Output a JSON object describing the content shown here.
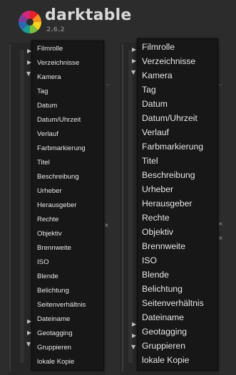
{
  "header": {
    "app_name": "darktable",
    "version": "2.6.2"
  },
  "colors": {
    "background": "#2c2c2c",
    "menu_background": "#171717",
    "menu_text": "#e6e6e6",
    "logo_segments": [
      "#e8202a",
      "#f39220",
      "#f7d51c",
      "#7cbf3b",
      "#1d9b8f",
      "#2a67b1",
      "#7a3f98",
      "#d0287a"
    ]
  },
  "icons": {
    "logo": "darktable-aperture-logo",
    "expander": "triangle-right-icon",
    "collapser": "triangle-down-icon"
  },
  "left_menu": {
    "items": [
      "Filmrolle",
      "Verzeichnisse",
      "Kamera",
      "Tag",
      "Datum",
      "Datum/Uhrzeit",
      "Verlauf",
      "Farbmarkierung",
      "Titel",
      "Beschreibung",
      "Urheber",
      "Herausgeber",
      "Rechte",
      "Objektiv",
      "Brennweite",
      "ISO",
      "Blende",
      "Belichtung",
      "Seitenverhältnis",
      "Dateiname",
      "Geotagging",
      "Gruppieren",
      "lokale Kopie"
    ]
  },
  "right_menu": {
    "items": [
      "Filmrolle",
      "Verzeichnisse",
      "Kamera",
      "Tag",
      "Datum",
      "Datum/Uhrzeit",
      "Verlauf",
      "Farbmarkierung",
      "Titel",
      "Beschreibung",
      "Urheber",
      "Herausgeber",
      "Rechte",
      "Objektiv",
      "Brennweite",
      "ISO",
      "Blende",
      "Belichtung",
      "Seitenverhältnis",
      "Dateiname",
      "Geotagging",
      "Gruppieren",
      "lokale Kopie"
    ]
  }
}
